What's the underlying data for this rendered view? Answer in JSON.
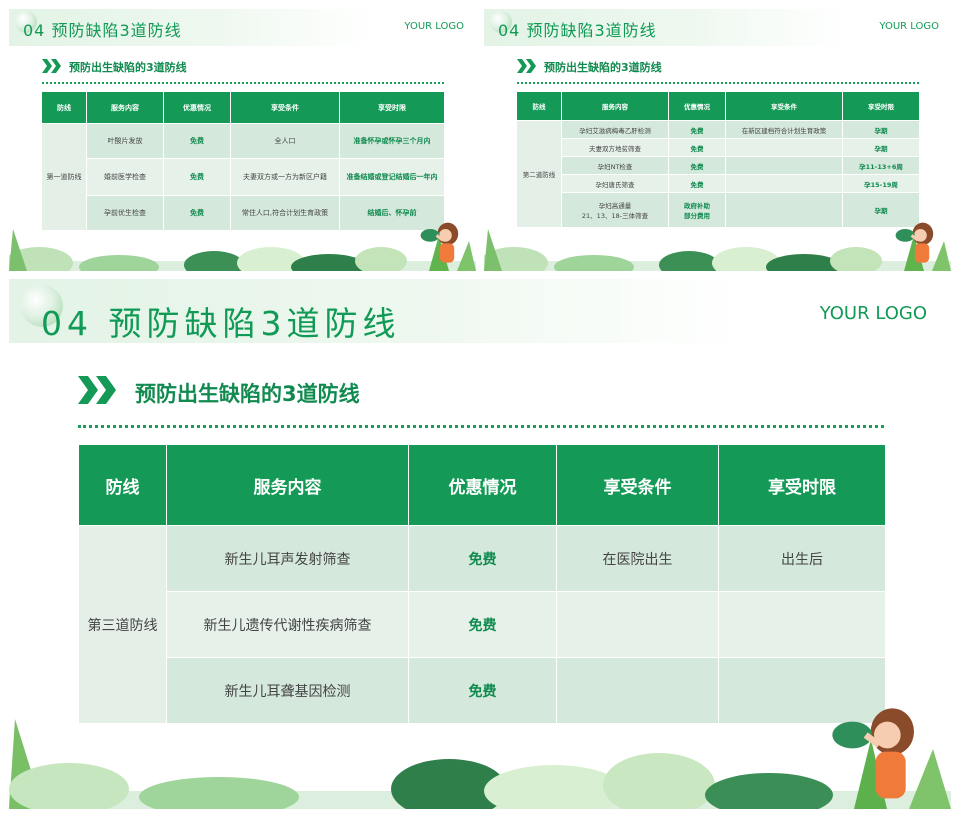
{
  "header": {
    "number": "04",
    "title": "预防缺陷3道防线",
    "logo": "YOUR LOGO"
  },
  "section_title": "预防出生缺陷的3道防线",
  "columns": [
    "防线",
    "服务内容",
    "优惠情况",
    "享受条件",
    "享受时限"
  ],
  "slide1": {
    "lead": "第一道防线",
    "rows": [
      {
        "service": "叶酸片发放",
        "discount": "免费",
        "condition": "全人口",
        "period": "准备怀孕或怀孕三个月内"
      },
      {
        "service": "婚前医学检查",
        "discount": "免费",
        "condition": "夫妻双方或一方为新区户籍",
        "period": "准备结婚或登记结婚后一年内"
      },
      {
        "service": "孕前优生检查",
        "discount": "免费",
        "condition": "常住人口,符合计划生育政策",
        "period": "结婚后、怀孕前"
      }
    ]
  },
  "slide2": {
    "lead": "第二道防线",
    "rows": [
      {
        "service": "孕妇艾滋病梅毒乙肝检测",
        "discount": "免费",
        "condition": "在新区建档符合计划生育政策",
        "period": "孕期"
      },
      {
        "service": "夫妻双方地贫筛查",
        "discount": "免费",
        "condition": "",
        "period": "孕期"
      },
      {
        "service": "孕妇NT检查",
        "discount": "免费",
        "condition": "",
        "period": "孕11-13+6周"
      },
      {
        "service": "孕妇唐氏筛查",
        "discount": "免费",
        "condition": "",
        "period": "孕15-19周"
      },
      {
        "service_line1": "孕妇高通量",
        "service_line2": "21、13、18-三体筛查",
        "discount_line1": "政府补助",
        "discount_line2": "部分费用",
        "condition": "",
        "period": "孕期"
      }
    ]
  },
  "slide3": {
    "lead": "第三道防线",
    "rows": [
      {
        "service": "新生儿耳声发射筛查",
        "discount": "免费",
        "condition": "在医院出生",
        "period": "出生后"
      },
      {
        "service": "新生儿遗传代谢性疾病筛查",
        "discount": "免费",
        "condition": "",
        "period": ""
      },
      {
        "service": "新生儿耳聋基因检测",
        "discount": "免费",
        "condition": "",
        "period": ""
      }
    ]
  },
  "colors": {
    "accent": "#149a56",
    "cell": "#d5e8dc",
    "cell_alt": "#e6f1ea",
    "text_green": "#0f8a4e"
  },
  "icons": [
    "double-chevron-icon",
    "leaf-decoration",
    "girl-illustration"
  ]
}
